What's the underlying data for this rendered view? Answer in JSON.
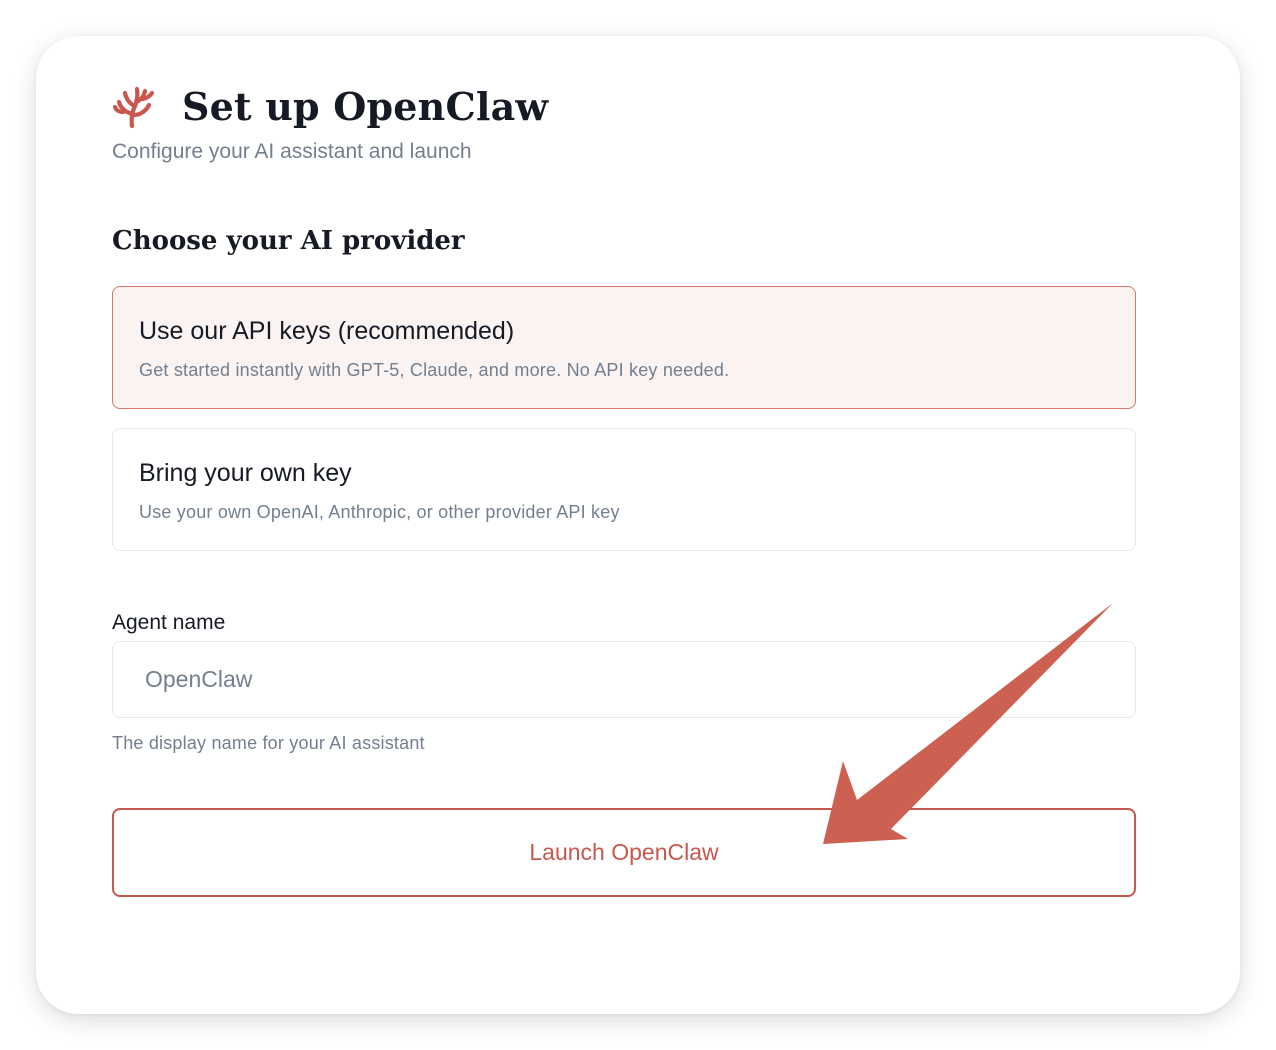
{
  "header": {
    "title": "Set up OpenClaw",
    "subtitle": "Configure your AI assistant and launch",
    "logo_icon": "coral-claw-icon",
    "logo_color": "#c8574e"
  },
  "provider": {
    "section_title": "Choose your AI provider",
    "options": [
      {
        "title": "Use our API keys (recommended)",
        "description": "Get started instantly with GPT-5, Claude, and more. No API key needed.",
        "selected": true
      },
      {
        "title": "Bring your own key",
        "description": "Use your own OpenAI, Anthropic, or other provider API key",
        "selected": false
      }
    ]
  },
  "agent": {
    "label": "Agent name",
    "placeholder": "OpenClaw",
    "value": "",
    "help": "The display name for your AI assistant"
  },
  "launch": {
    "label": "Launch OpenClaw"
  },
  "colors": {
    "accent": "#c8574e",
    "selected_bg": "#faf3f2",
    "selected_border": "#d9776a",
    "muted_text": "#737f8e",
    "dark_text": "#161a24",
    "annotation_arrow": "#cd6151"
  },
  "annotation": {
    "icon": "pointer-arrow-icon",
    "points_to": "launch-button"
  }
}
